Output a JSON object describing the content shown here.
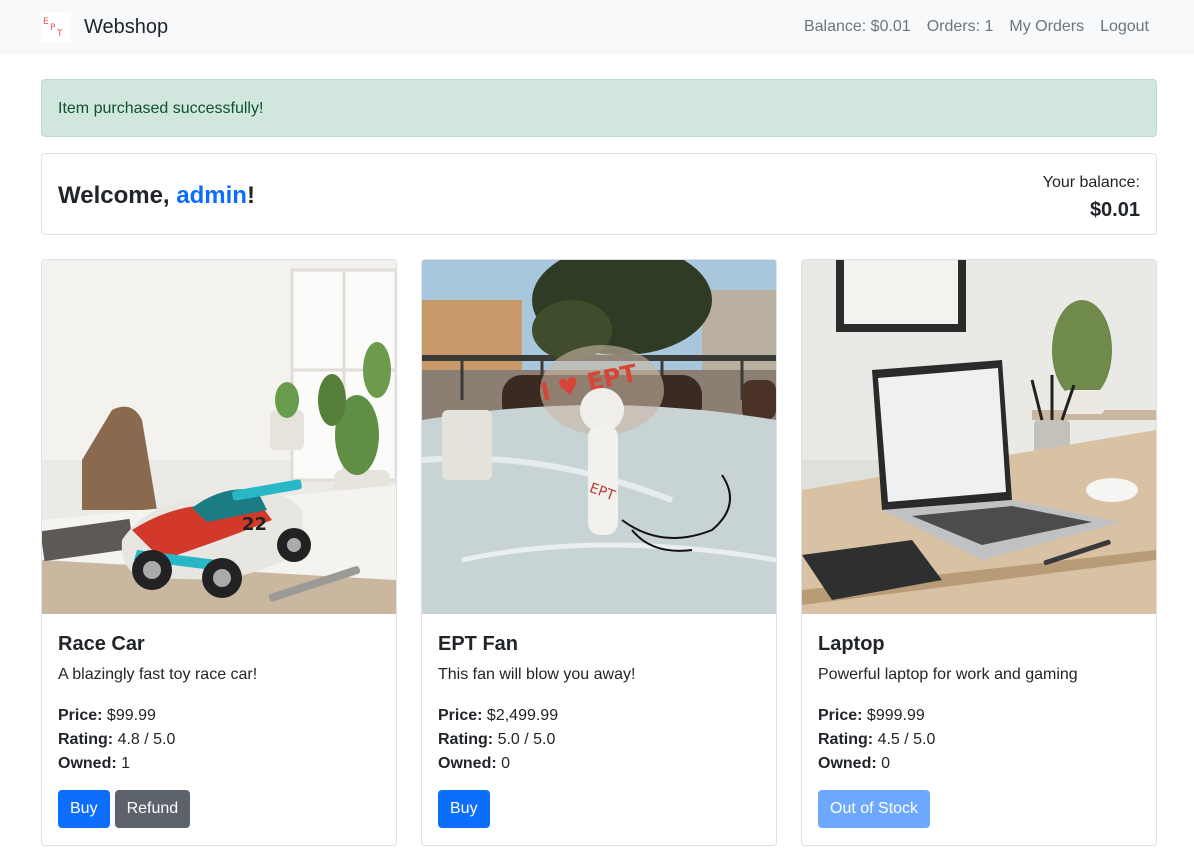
{
  "navbar": {
    "brand": "Webshop",
    "balance": "Balance: $0.01",
    "orders": "Orders: 1",
    "my_orders": "My Orders",
    "logout": "Logout"
  },
  "alert": {
    "message": "Item purchased successfully!"
  },
  "welcome": {
    "prefix": "Welcome, ",
    "username": "admin",
    "suffix": "!",
    "balance_label": "Your balance:",
    "balance_value": "$0.01"
  },
  "products": [
    {
      "title": "Race Car",
      "description": "A blazingly fast toy race car!",
      "price_label": "Price:",
      "price": "$99.99",
      "rating_label": "Rating:",
      "rating": "4.8 / 5.0",
      "owned_label": "Owned:",
      "owned": "1",
      "buy_label": "Buy",
      "refund_label": "Refund"
    },
    {
      "title": "EPT Fan",
      "description": "This fan will blow you away!",
      "price_label": "Price:",
      "price": "$2,499.99",
      "rating_label": "Rating:",
      "rating": "5.0 / 5.0",
      "owned_label": "Owned:",
      "owned": "0",
      "buy_label": "Buy"
    },
    {
      "title": "Laptop",
      "description": "Powerful laptop for work and gaming",
      "price_label": "Price:",
      "price": "$999.99",
      "rating_label": "Rating:",
      "rating": "4.5 / 5.0",
      "owned_label": "Owned:",
      "owned": "0",
      "out_of_stock_label": "Out of Stock"
    }
  ],
  "colors": {
    "primary": "#0d6efd",
    "secondary": "#5c636a",
    "alert_bg": "#d1e7dd",
    "alert_text": "#0f5132",
    "navbar_bg": "#f8f9fa"
  },
  "icons": {
    "brand_logo": "ept-logo-icon"
  }
}
